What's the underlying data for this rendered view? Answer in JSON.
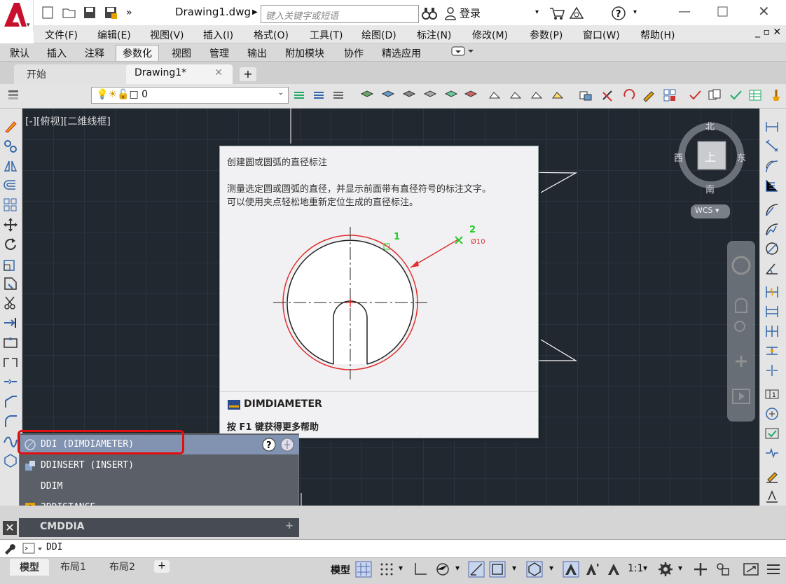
{
  "window": {
    "file_title": "Drawing1.dwg",
    "search_placeholder": "键入关键字或短语",
    "login_label": "登录"
  },
  "menubar": {
    "items": [
      "文件(F)",
      "编辑(E)",
      "视图(V)",
      "插入(I)",
      "格式(O)",
      "工具(T)",
      "绘图(D)",
      "标注(N)",
      "修改(M)",
      "参数(P)",
      "窗口(W)",
      "帮助(H)"
    ]
  },
  "ribbon": {
    "tabs": [
      "默认",
      "插入",
      "注释",
      "参数化",
      "视图",
      "管理",
      "输出",
      "附加模块",
      "协作",
      "精选应用"
    ],
    "active": "参数化"
  },
  "filetabs": {
    "start": "开始",
    "drawing": "Drawing1*"
  },
  "layer": {
    "current": "0"
  },
  "viewport": {
    "label": "[-][俯视][二维线框]"
  },
  "viewcube": {
    "north": "北",
    "south": "南",
    "east": "东",
    "west": "西",
    "top": "上",
    "wcs": "WCS"
  },
  "tooltip": {
    "title": "创建圆或圆弧的直径标注",
    "desc_line1": "测量选定圆或圆弧的直径，并显示前面带有直径符号的标注文字。",
    "desc_line2": "可以使用夹点轻松地重新定位生成的直径标注。",
    "fig_label1": "1",
    "fig_label2": "2",
    "fig_dim": "Ø10",
    "command": "DIMDIAMETER",
    "help": "按 F1 键获得更多帮助"
  },
  "autocomplete": {
    "items": [
      "DDI (DIMDIAMETER)",
      "DDINSERT (INSERT)",
      "DDIM",
      "3DDISTANCE"
    ],
    "history_label": "CMDDIA"
  },
  "command_line": {
    "input": "DDI"
  },
  "statusbar": {
    "layout_tabs": [
      "模型",
      "布局1",
      "布局2"
    ],
    "model_label": "模型",
    "scale": "1:1"
  },
  "colors": {
    "canvas": "#212830",
    "accent_red": "#e01010",
    "autocomplete_bg": "#5b6068"
  }
}
